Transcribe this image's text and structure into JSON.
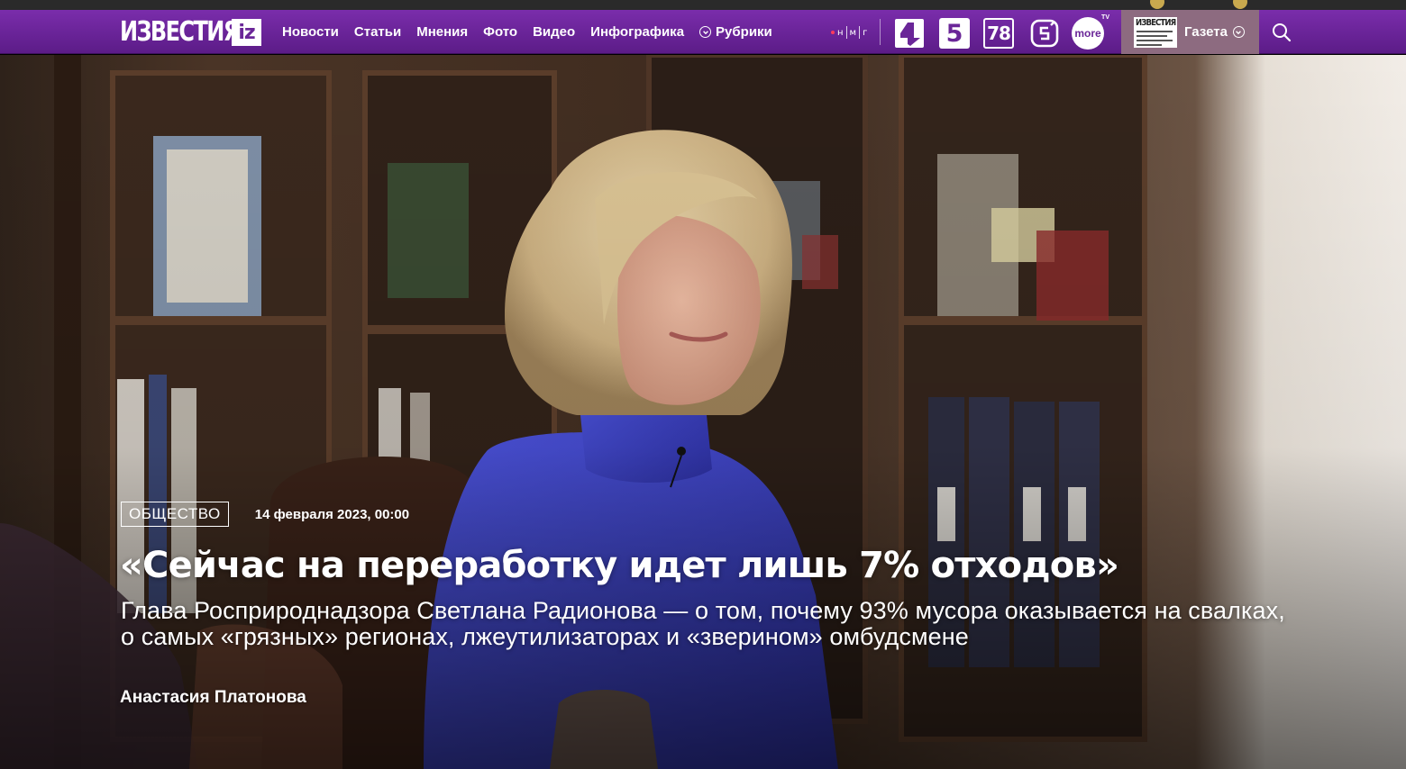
{
  "header": {
    "logo_word": "ИЗВЕСТИЯ",
    "logo_short": "iz",
    "nav": [
      {
        "label": "Новости"
      },
      {
        "label": "Статьи"
      },
      {
        "label": "Мнения"
      },
      {
        "label": "Фото"
      },
      {
        "label": "Видео"
      },
      {
        "label": "Инфографика"
      },
      {
        "label": "Рубрики"
      }
    ],
    "nmg_letters": [
      "н",
      "м",
      "г"
    ],
    "channels": {
      "five": "5",
      "seventy_eight": "78",
      "more": "more",
      "more_tv": "TV"
    },
    "gazeta": {
      "thumb_masthead": "ИЗВЕСТИЯ",
      "label": "Газета"
    },
    "icons": {
      "rubrics": "chevron-down-circle-icon",
      "gazeta": "chevron-down-circle-icon",
      "search": "search-icon"
    }
  },
  "article": {
    "rubric": "ОБЩЕСТВО",
    "date": "14 февраля 2023, 00:00",
    "title": "«Сейчас на переработку идет лишь 7% отходов»",
    "lead": "Глава Росприроднадзора Светлана Радионова — о том, почему 93% мусора оказывается на свалках, о самых «грязных» регионах, лжеутилизаторах и «зверином» омбудсмене",
    "author": "Анастасия Платонова"
  },
  "colors": {
    "nav_purple": "#6a2698",
    "gazeta_bg": "#8d6b80",
    "sweater_blue": "#3a3fc4"
  }
}
